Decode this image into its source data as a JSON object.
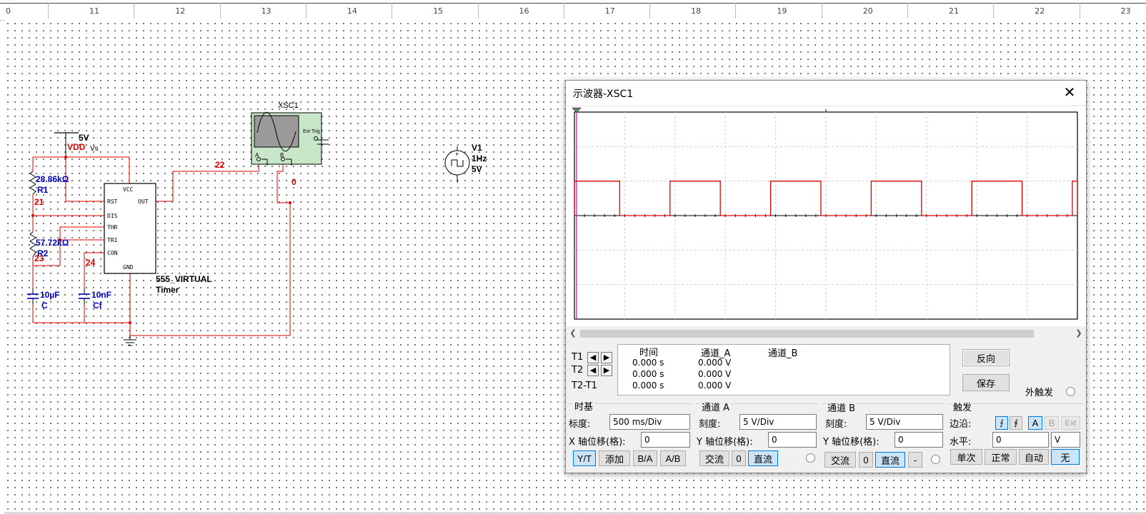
{
  "ruler": {
    "labels": [
      "0",
      "11",
      "12",
      "13",
      "14",
      "15",
      "16",
      "17",
      "18",
      "19",
      "20",
      "21",
      "22",
      "23"
    ]
  },
  "schematic": {
    "vcc_voltage": "5V",
    "vcc_name": "VDD",
    "vcc_overlap": "Vs",
    "r1_value": "28.86kΩ",
    "r1_name": "R1",
    "r2_value": "57.72kΩ",
    "r2_name": "R2",
    "c_value": "10µF",
    "c_name": "C",
    "cf_value": "10nF",
    "cf_name": "Cf",
    "net_21": "21",
    "net_23": "23",
    "net_24": "24",
    "net_22": "22",
    "net_0": "0",
    "timer_name": "555_VIRTUAL",
    "timer_type": "Timer",
    "pins": {
      "vcc": "VCC",
      "rst": "RST",
      "out": "OUT",
      "dis": "DIS",
      "thr": "THR",
      "tri": "TRI",
      "con": "CON",
      "gnd": "GND"
    },
    "xsc_name": "XSC1",
    "xsc_ext_trig": "Ext Trig",
    "xsc_ch_a": "A",
    "xsc_ch_b": "B",
    "v1_name": "V1",
    "v1_freq": "1Hz",
    "v1_amp": "5V"
  },
  "oscilloscope": {
    "title": "示波器-XSC1",
    "close_glyph": "✕",
    "waveform": {
      "channel_a_color": "#e00000",
      "high_level_div": 1,
      "high_segments": [
        [
          0,
          0.9
        ],
        [
          1.9,
          2.9
        ],
        [
          3.9,
          4.9
        ],
        [
          5.9,
          6.9
        ],
        [
          7.9,
          8.9
        ],
        [
          9.9,
          10
        ]
      ]
    },
    "readout": {
      "t1_label": "T1",
      "t2_label": "T2",
      "t2t1_label": "T2-T1",
      "col_time": "时间",
      "col_a": "通道_A",
      "col_b": "通道_B",
      "rows": [
        {
          "time": "0.000 s",
          "a": "0.000 V"
        },
        {
          "time": "0.000 s",
          "a": "0.000 V"
        },
        {
          "time": "0.000 s",
          "a": "0.000 V"
        }
      ]
    },
    "reverse_label": "反向",
    "save_label": "保存",
    "ext_trigger_label": "外触发",
    "timebase": {
      "title": "时基",
      "scale_label": "标度:",
      "scale_value": "500 ms/Div",
      "xpos_label": "X 轴位移(格):",
      "xpos_value": "0",
      "buttons": [
        "Y/T",
        "添加",
        "B/A",
        "A/B"
      ]
    },
    "channel_a": {
      "title": "通道 A",
      "scale_label": "刻度:",
      "scale_value": "5  V/Div",
      "ypos_label": "Y 轴位移(格):",
      "ypos_value": "0",
      "buttons": [
        "交流",
        "0",
        "直流"
      ]
    },
    "channel_b": {
      "title": "通道 B",
      "scale_label": "刻度:",
      "scale_value": "5  V/Div",
      "ypos_label": "Y 轴位移(格):",
      "ypos_value": "0",
      "buttons": [
        "交流",
        "0",
        "直流",
        "-"
      ]
    },
    "trigger": {
      "title": "触发",
      "edge_label": "边沿:",
      "level_label": "水平:",
      "level_value": "0",
      "level_unit": "V",
      "source_buttons": [
        "A",
        "B",
        "Ext"
      ],
      "mode_buttons": [
        "单次",
        "正常",
        "自动",
        "无"
      ]
    }
  }
}
